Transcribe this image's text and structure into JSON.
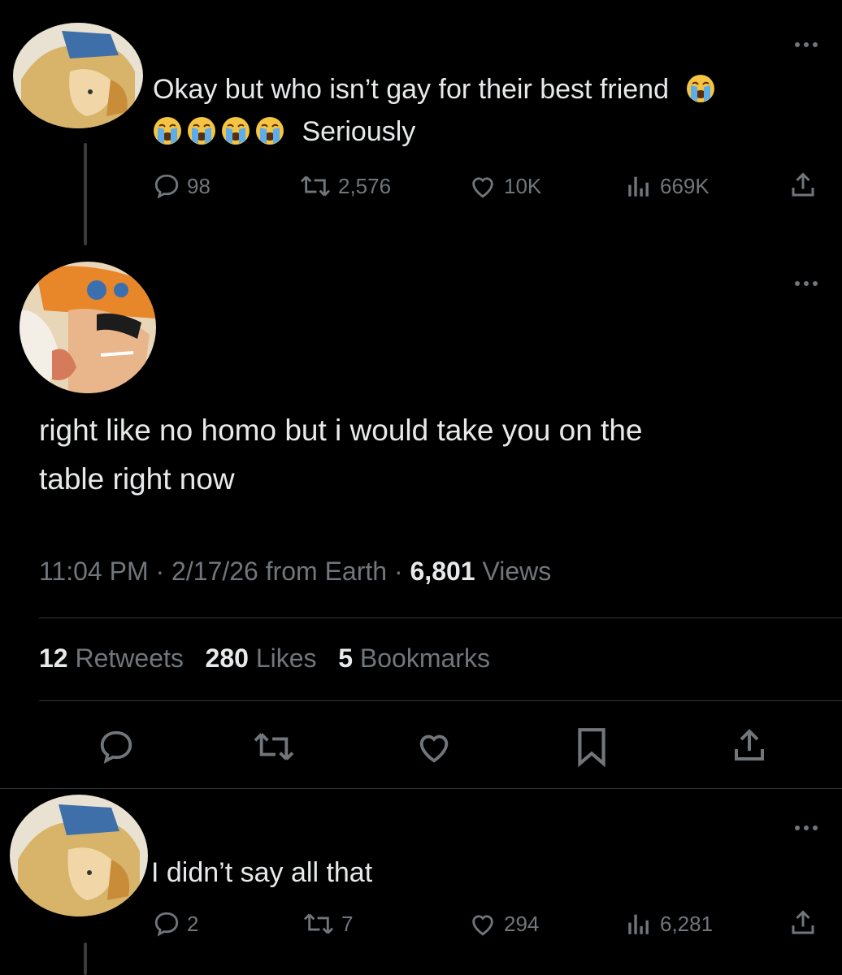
{
  "colors": {
    "background": "#000000",
    "text": "#e7e9ea",
    "muted": "#71767b",
    "divider": "#2f3336"
  },
  "tweet1": {
    "text_line1": "Okay but who isn’t gay for their best friend",
    "text_line2_suffix": "Seriously",
    "emoji": "loudly-crying-face",
    "replies": "98",
    "retweets": "2,576",
    "likes": "10K",
    "views": "669K"
  },
  "tweet2": {
    "text_line1": "right like no homo but i would take you on the",
    "text_line2": "table right now",
    "time": "11:04 PM",
    "date": "2/17/26",
    "source": "from Earth",
    "views_count": "6,801",
    "views_label": "Views",
    "retweets_count": "12",
    "retweets_label": "Retweets",
    "likes_count": "280",
    "likes_label": "Likes",
    "bookmarks_count": "5",
    "bookmarks_label": "Bookmarks",
    "sep": "·"
  },
  "tweet3": {
    "text": "I didn’t say all that",
    "replies": "2",
    "retweets": "7",
    "likes": "294",
    "views": "6,281"
  }
}
